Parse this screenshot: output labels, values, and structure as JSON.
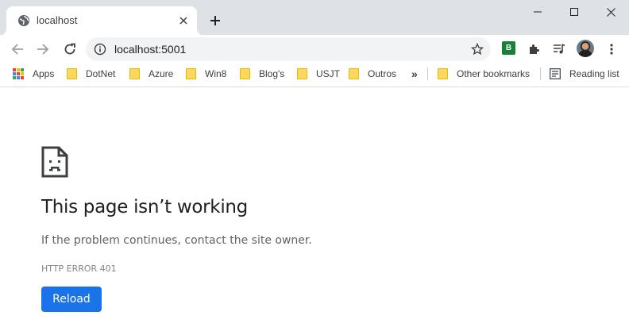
{
  "tab": {
    "title": "localhost",
    "favicon": "globe-icon"
  },
  "window": {
    "minimize": "minimize-icon",
    "maximize": "maximize-icon",
    "close": "close-icon"
  },
  "toolbar": {
    "back": "back-arrow-icon",
    "forward": "forward-arrow-icon",
    "reload": "reload-icon",
    "url": "localhost:5001",
    "bookmark_star": "star-icon",
    "extension_badge": "B",
    "extensions": "puzzle-icon",
    "media": "media-queue-icon",
    "menu": "kebab-menu-icon"
  },
  "bookmarks": {
    "items": [
      {
        "label": "Apps",
        "icon": "apps-grid-icon"
      },
      {
        "label": "DotNet",
        "icon": "folder-icon"
      },
      {
        "label": "Azure",
        "icon": "folder-icon"
      },
      {
        "label": "Win8",
        "icon": "folder-icon"
      },
      {
        "label": "Blog's",
        "icon": "folder-icon"
      },
      {
        "label": "USJT",
        "icon": "folder-icon"
      },
      {
        "label": "Outros",
        "icon": "folder-icon"
      }
    ],
    "overflow": "»",
    "other": "Other bookmarks",
    "reading_list": "Reading list"
  },
  "error_page": {
    "icon": "sad-document-icon",
    "title": "This page isn’t working",
    "message": "If the problem continues, contact the site owner.",
    "code": "HTTP ERROR 401",
    "reload_label": "Reload"
  },
  "colors": {
    "tabstrip": "#dee1e6",
    "accent": "#1a73e8",
    "folder": "#fdd663",
    "extension": "#188038"
  }
}
